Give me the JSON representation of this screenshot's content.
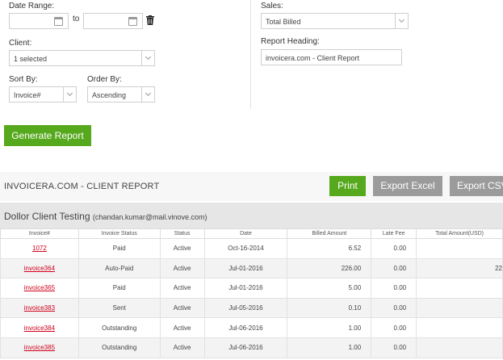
{
  "filters": {
    "date_range_label": "Date Range:",
    "to_label": "to",
    "from_value": "",
    "to_value": "",
    "client_label": "Client:",
    "client_value": "1 selected",
    "sort_by_label": "Sort By:",
    "sort_by_value": "Invoice#",
    "order_by_label": "Order By:",
    "order_by_value": "Ascending",
    "sales_label": "Sales:",
    "sales_value": "Total Billed",
    "report_heading_label": "Report Heading:",
    "report_heading_value": "invoicera.com - Client Report",
    "generate_label": "Generate Report"
  },
  "report": {
    "title": "INVOICERA.COM - CLIENT REPORT",
    "print_label": "Print",
    "export_excel_label": "Export Excel",
    "export_csv_label": "Export CSV",
    "client_name": "Dollor Client Testing",
    "client_email": "(chandan.kumar@mail.vinove.com)"
  },
  "table": {
    "columns": [
      "Invoice#",
      "Invoice Status",
      "Status",
      "Date",
      "Billed Amount",
      "Late Fee",
      "Total Amount(USD)"
    ],
    "rows": [
      {
        "invoice": "1072",
        "invoice_status": "Paid",
        "status": "Active",
        "date": "Oct-16-2014",
        "billed": "6.52",
        "late_fee": "0.00",
        "total": ""
      },
      {
        "invoice": "invoice364",
        "invoice_status": "Auto-Paid",
        "status": "Active",
        "date": "Jul-01-2016",
        "billed": "226.00",
        "late_fee": "0.00",
        "total": "22"
      },
      {
        "invoice": "invoice365",
        "invoice_status": "Paid",
        "status": "Active",
        "date": "Jul-01-2016",
        "billed": "5.00",
        "late_fee": "0.00",
        "total": ""
      },
      {
        "invoice": "invoice383",
        "invoice_status": "Sent",
        "status": "Active",
        "date": "Jul-05-2016",
        "billed": "0.10",
        "late_fee": "0.00",
        "total": ""
      },
      {
        "invoice": "invoice384",
        "invoice_status": "Outstanding",
        "status": "Active",
        "date": "Jul-06-2016",
        "billed": "1.00",
        "late_fee": "0.00",
        "total": ""
      },
      {
        "invoice": "invoice385",
        "invoice_status": "Outstanding",
        "status": "Active",
        "date": "Jul-06-2016",
        "billed": "1.00",
        "late_fee": "0.00",
        "total": ""
      }
    ]
  },
  "colors": {
    "primary_green": "#56a81d",
    "secondary_gray": "#9b9b9b",
    "link_red": "#d0021b"
  }
}
